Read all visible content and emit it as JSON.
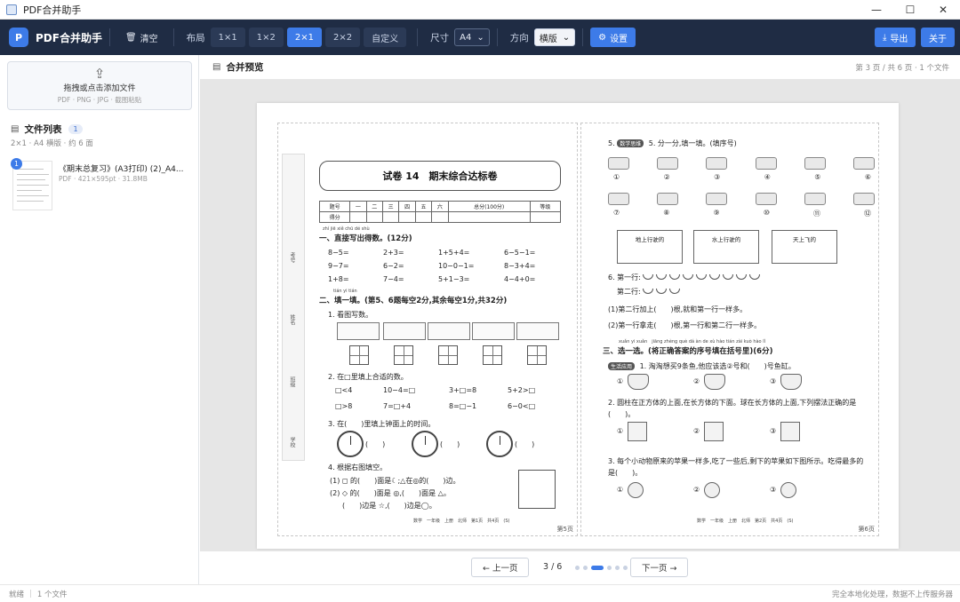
{
  "window": {
    "title": "PDF合并助手",
    "controls": [
      "—",
      "☐",
      "✕"
    ]
  },
  "toolbar": {
    "brand_logo": "P",
    "brand_name": "PDF合并助手",
    "clear_label": "清空",
    "layout_label": "布局",
    "layouts": [
      {
        "label": "1×1",
        "active": false
      },
      {
        "label": "1×2",
        "active": false
      },
      {
        "label": "2×1",
        "active": true
      },
      {
        "label": "2×2",
        "active": false
      },
      {
        "label": "自定义",
        "active": false
      }
    ],
    "size_label": "尺寸",
    "size_value": "A4",
    "orientation_label": "方向",
    "orientation_value": "横版",
    "settings_label": "设置",
    "export_label": "导出",
    "about_label": "关于"
  },
  "sidebar": {
    "drop_main": "拖拽或点击添加文件",
    "drop_sub": "PDF · PNG · JPG · 截图粘贴",
    "file_list_title": "文件列表",
    "file_count": "1",
    "file_list_sub": "2×1 · A4 横版 · 约 6 面",
    "files": [
      {
        "index": "1",
        "name": "《期末总复习》(A3打印) (2)_A4...",
        "meta": "PDF · 421×595pt · 31.8MB"
      }
    ]
  },
  "main": {
    "title": "合并预览",
    "info": "第 3 页 / 共 6 页 · 1 个文件"
  },
  "preview": {
    "left": {
      "exam_title": "试卷 14　期末综合达标卷",
      "binding_labels": [
        "考号",
        "姓名",
        "班级",
        "学校"
      ],
      "table_row1": [
        "题号",
        "一",
        "二",
        "三",
        "四",
        "五",
        "六",
        "总分(100分)",
        "等级"
      ],
      "table_row2": [
        "得分",
        "",
        "",
        "",
        "",
        "",
        "",
        "",
        ""
      ],
      "sec1_title": "一、直接写出得数。(12分)",
      "sec1_pinyin": "zhí jiē xiě chū dé shù",
      "sec1_rows": [
        [
          "8−5=",
          "2+3=",
          "1+5+4=",
          "6−5−1="
        ],
        [
          "9−7=",
          "6−2=",
          "10−0−1=",
          "8−3+4="
        ],
        [
          "1+8=",
          "7−4=",
          "5+1−3=",
          "4−4+0="
        ]
      ],
      "sec2_pinyin": "tián yi tián",
      "sec2_title": "二、填一填。(第5、6题每空2分,其余每空1分,共32分)",
      "q1": "1. 看图写数。",
      "q2": "2. 在□里填上合适的数。",
      "q2_rows": [
        [
          "□<4",
          "10−4=□",
          "3+□=8",
          "5+2>□"
        ],
        [
          "□>8",
          "7=□+4",
          "8=□−1",
          "6−0<□"
        ]
      ],
      "q3": "3. 在(　　)里填上钟面上的时间。",
      "q3_paren": "(　　)",
      "q4": "4. 根据右图填空。",
      "q4_lines": [
        "(1) ◻ 的(　　)面是☾;△在◎的(　　)边。",
        "(2) ◇ 的(　　)面是 ◎,(　　)面是 △。",
        "(　　)边是 ☆,(　　)边是◯。"
      ],
      "footer": "数学　一年级　上册　北师　第1页　共4页　(S)",
      "page_tag": "第5页"
    },
    "right": {
      "q5": "5. 分一分,填一填。(填序号)",
      "q5_tag": "数学思维",
      "nums_row1": [
        "①",
        "②",
        "③",
        "④",
        "⑤",
        "⑥"
      ],
      "nums_row2": [
        "⑦",
        "⑧",
        "⑨",
        "⑩",
        "⑪",
        "⑫"
      ],
      "boxes": [
        "地上行驶的",
        "水上行驶的",
        "天上飞的"
      ],
      "q6_line1": "6. 第一行:",
      "q6_line2": "第二行:",
      "q6_a": "(1)第二行加上(　　)根,就和第一行一样多。",
      "q6_b": "(2)第一行拿走(　　)根,第一行和第二行一样多。",
      "sec3_pinyin": "xuǎn yi xuǎn　jiāng zhèng què dá àn de xù hào tián zài kuò hào lǐ",
      "sec3_title": "三、选一选。(将正确答案的序号填在括号里)(6分)",
      "s1": "1. 淘淘想买9条鱼,他应该选②号和(　　)号鱼缸。",
      "s1_tag": "生活应用",
      "s2": "2. 圆柱在正方体的上面,在长方体的下面。球在长方体的上面,下列摆法正确的是(　　)。",
      "s3": "3. 每个小动物原来的苹果一样多,吃了一些后,剩下的苹果如下图所示。吃得最多的是(　　)。",
      "opt_marks": [
        "①",
        "②",
        "③"
      ],
      "footer": "数学　一年级　上册　北师　第2页　共4页　(S)",
      "page_tag": "第6页"
    }
  },
  "pager": {
    "prev_label": "← 上一页",
    "next_label": "下一页 →",
    "page_info": "3 / 6",
    "dots": 6,
    "active_dot": 2
  },
  "status": {
    "left_a": "就绪",
    "left_b": "1 个文件",
    "right": "完全本地化处理，数据不上传服务器"
  },
  "colors": {
    "accent": "#3d7be8",
    "toolbar_bg": "#1f2c44",
    "canvas_bg": "#e6e6e6"
  },
  "icons": [
    "app-icon",
    "trash-icon",
    "gear-icon",
    "download-icon",
    "upload-icon",
    "document-icon"
  ]
}
